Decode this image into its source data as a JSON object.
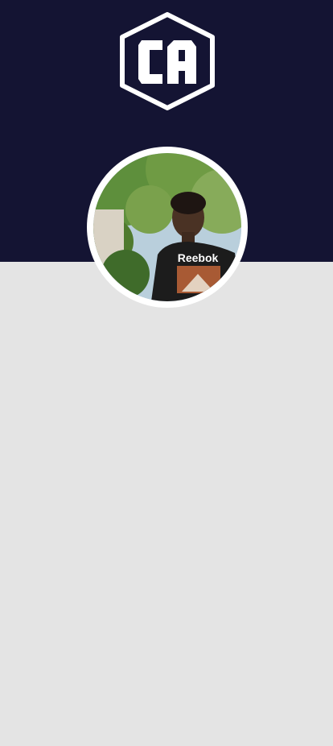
{
  "header": {
    "background_color": "#141433",
    "logo": {
      "icon": "ca-hexagon-logo-icon",
      "text": "CA",
      "color": "#ffffff"
    }
  },
  "profile": {
    "avatar_icon": "profile-photo",
    "shirt_text": "Reebok"
  },
  "content": {
    "background_color": "#e4e4e4"
  }
}
